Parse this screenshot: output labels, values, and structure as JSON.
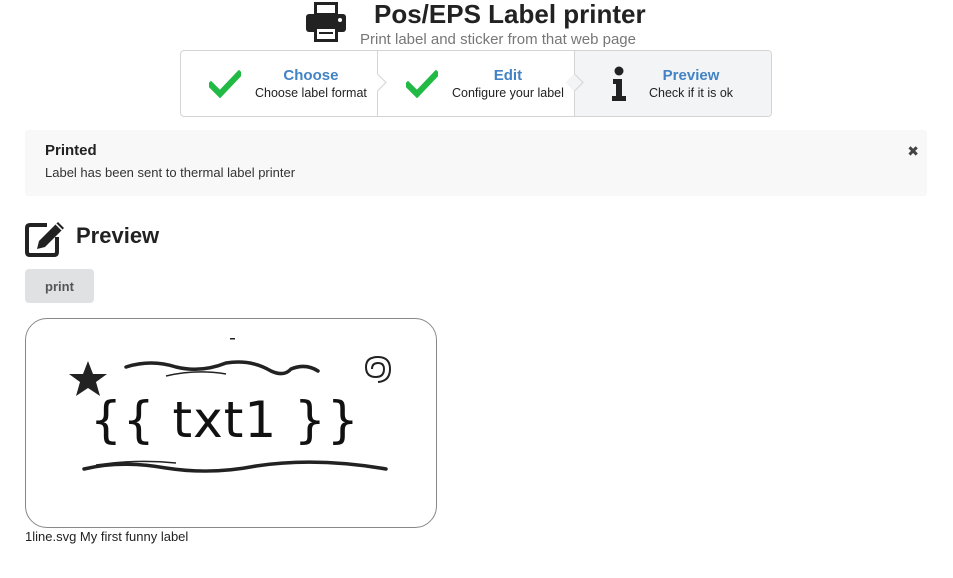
{
  "header": {
    "title": "Pos/EPS Label printer",
    "subtitle": "Print label and sticker from that web page",
    "icon": "printer-icon"
  },
  "steps": [
    {
      "title": "Choose",
      "description": "Choose label format",
      "icon": "check-icon",
      "state": "completed"
    },
    {
      "title": "Edit",
      "description": "Configure your label",
      "icon": "check-icon",
      "state": "completed"
    },
    {
      "title": "Preview",
      "description": "Check if it is ok",
      "icon": "info-icon",
      "state": "active"
    }
  ],
  "message": {
    "header": "Printed",
    "body": "Label has been sent to thermal label printer",
    "close_icon": "close-icon"
  },
  "preview": {
    "title": "Preview",
    "icon": "edit-icon",
    "print_label": "print",
    "label_text": "{{ txt1 }}",
    "caption": "1line.svg My first funny label"
  },
  "colors": {
    "accent": "#4183c4",
    "check": "#21ba45",
    "message_bg": "#f8f8f9",
    "button_bg": "#e0e1e2"
  }
}
